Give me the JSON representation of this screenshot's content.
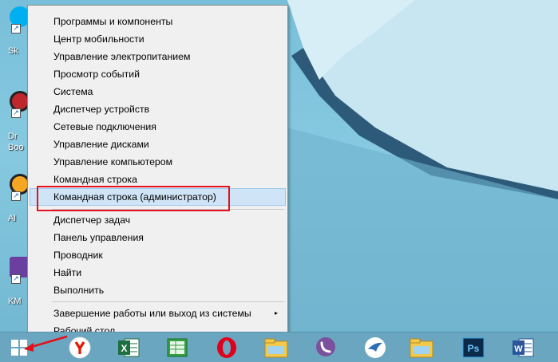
{
  "desktop": {
    "icons": [
      {
        "name": "skype",
        "label": "Sk"
      },
      {
        "name": "daemon-tools",
        "label": "Dr\nBoo"
      },
      {
        "name": "aimp",
        "label": "Al"
      },
      {
        "name": "kmplayer",
        "label": "KM"
      }
    ]
  },
  "menu": {
    "items": [
      {
        "label": "Программы и компоненты"
      },
      {
        "label": "Центр мобильности"
      },
      {
        "label": "Управление электропитанием"
      },
      {
        "label": "Просмотр событий"
      },
      {
        "label": "Система"
      },
      {
        "label": "Диспетчер устройств"
      },
      {
        "label": "Сетевые подключения"
      },
      {
        "label": "Управление дисками"
      },
      {
        "label": "Управление компьютером"
      },
      {
        "label": "Командная строка"
      },
      {
        "label": "Командная строка (администратор)"
      },
      {
        "label": "Диспетчер задач"
      },
      {
        "label": "Панель управления"
      },
      {
        "label": "Проводник"
      },
      {
        "label": "Найти"
      },
      {
        "label": "Выполнить"
      },
      {
        "label": "Завершение работы или выход из системы"
      },
      {
        "label": "Рабочий стол"
      }
    ],
    "submenu_arrow": "▸"
  },
  "taskbar": {
    "apps": [
      {
        "icon": "yandex-browser-icon"
      },
      {
        "icon": "excel-icon"
      },
      {
        "icon": "excel-green-icon"
      },
      {
        "icon": "opera-icon"
      },
      {
        "icon": "file-explorer-icon"
      },
      {
        "icon": "viber-icon"
      },
      {
        "icon": "bird-app-icon"
      },
      {
        "icon": "file-explorer-icon"
      },
      {
        "icon": "photoshop-icon"
      },
      {
        "icon": "word-icon"
      }
    ],
    "photoshop_label": "Ps",
    "excel_label": "X",
    "word_label": "W"
  },
  "colors": {
    "highlight_border": "#e3111b",
    "menu_hover": "#cfe4f7",
    "taskbar": "#6ba6c0"
  }
}
